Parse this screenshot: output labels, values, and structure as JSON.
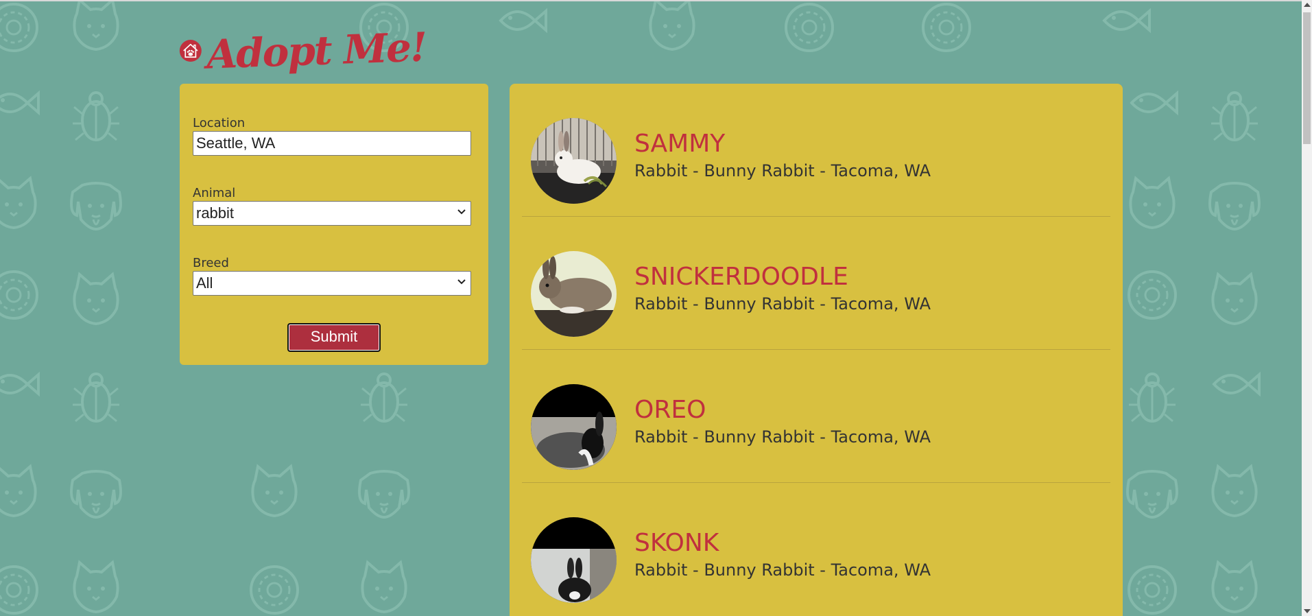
{
  "app": {
    "title": "Adopt Me!"
  },
  "search": {
    "location_label": "Location",
    "location_value": "Seattle, WA",
    "animal_label": "Animal",
    "animal_value": "rabbit",
    "breed_label": "Breed",
    "breed_value": "All",
    "submit_label": "Submit"
  },
  "pets": [
    {
      "name": "SAMMY",
      "info": "Rabbit - Bunny Rabbit - Tacoma, WA"
    },
    {
      "name": "SNICKERDOODLE",
      "info": "Rabbit - Bunny Rabbit - Tacoma, WA"
    },
    {
      "name": "OREO",
      "info": "Rabbit - Bunny Rabbit - Tacoma, WA"
    },
    {
      "name": "SKONK",
      "info": "Rabbit - Bunny Rabbit - Tacoma, WA"
    }
  ],
  "colors": {
    "background": "#6fa89a",
    "panel": "#d8c040",
    "brand_red": "#c0303e",
    "button": "#ad2f3e"
  },
  "icons": {
    "logo": "house-paw-icon",
    "select_arrow": "chevron-down-icon"
  }
}
